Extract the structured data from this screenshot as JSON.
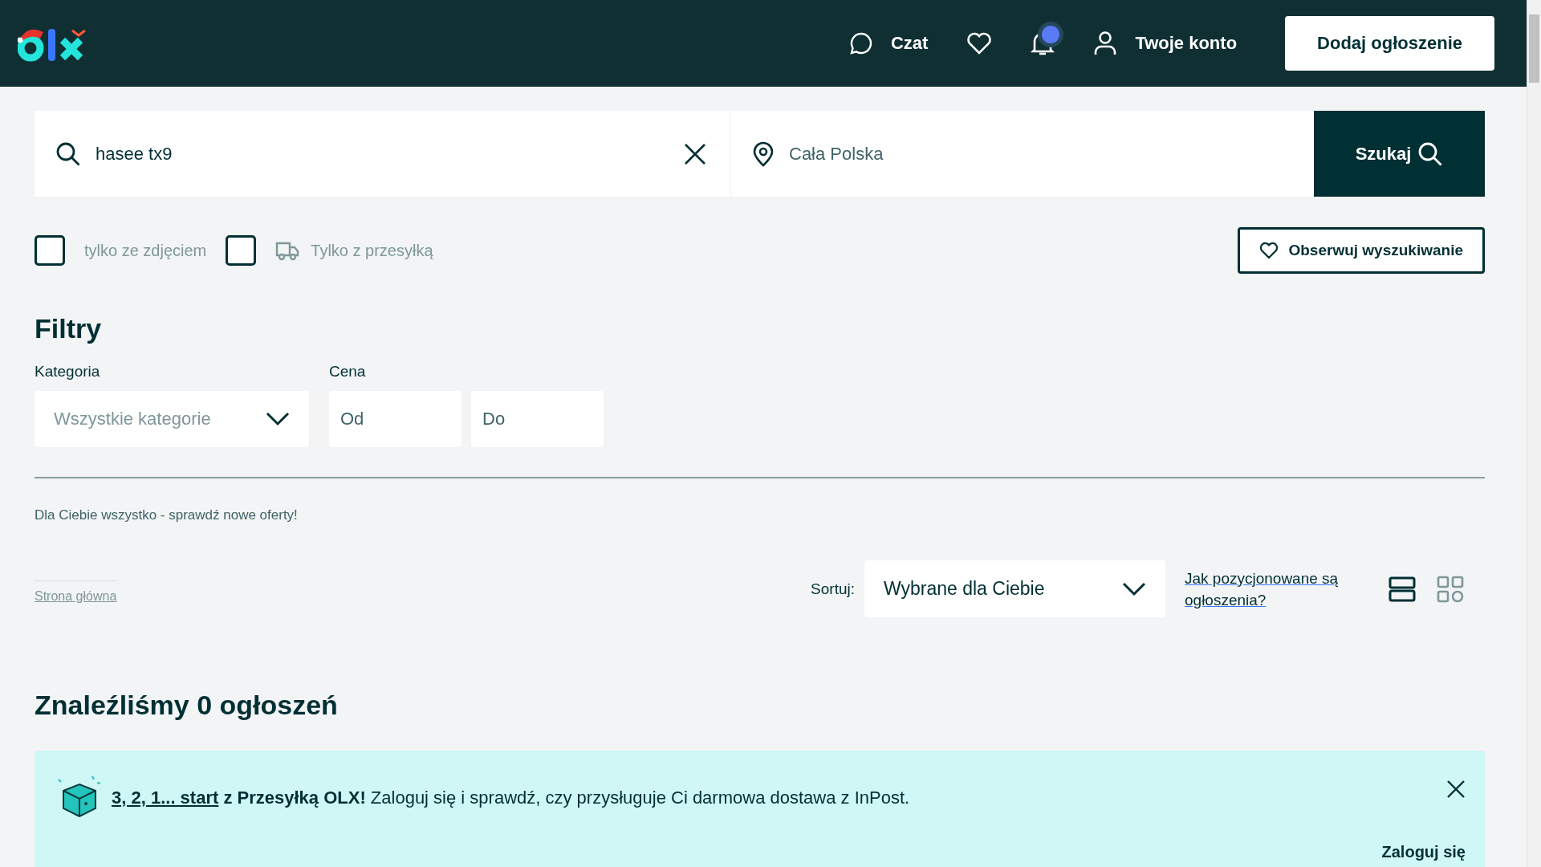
{
  "header": {
    "nav": [
      {
        "kind": "chat",
        "label": "Czat"
      },
      {
        "kind": "favorites"
      },
      {
        "kind": "notifications",
        "unread": true
      },
      {
        "kind": "account",
        "label": "Twoje konto"
      }
    ],
    "post_button": "Dodaj ogłoszenie"
  },
  "search": {
    "query": "hasee tx9",
    "location_placeholder": "Cała Polska",
    "button": "Szukaj"
  },
  "toggles": [
    {
      "kind": "plain",
      "label": "tylko ze zdjęciem",
      "checked": false
    },
    {
      "kind": "delivery",
      "label": "Tylko z przesyłką",
      "checked": false
    }
  ],
  "observe_button": "Obserwuj wyszukiwanie",
  "filters": {
    "title": "Filtry",
    "category": {
      "label": "Kategoria",
      "placeholder": "Wszystkie kategorie"
    },
    "price": {
      "label": "Cena",
      "from_placeholder": "Od",
      "to_placeholder": "Do"
    }
  },
  "promo_text": "Dla Ciebie wszystko - sprawdź nowe oferty!",
  "breadcrumb": "Strona główna",
  "sort": {
    "label": "Sortuj:",
    "value": "Wybrane dla Ciebie",
    "help_link": "Jak pozycjonowane są ogłoszenia?",
    "views": [
      {
        "kind": "list",
        "selected": true
      },
      {
        "kind": "grid",
        "selected": false
      }
    ]
  },
  "results_heading": "Znaleźliśmy 0 ogłoszeń",
  "banner": {
    "link": "3, 2, 1... start",
    "text": "**z Przesyłką OLX!** Zaloguj się i sprawdź, czy przysługuje Ci darmowa dostawa z InPost.",
    "action": "Zaloguj się"
  }
}
